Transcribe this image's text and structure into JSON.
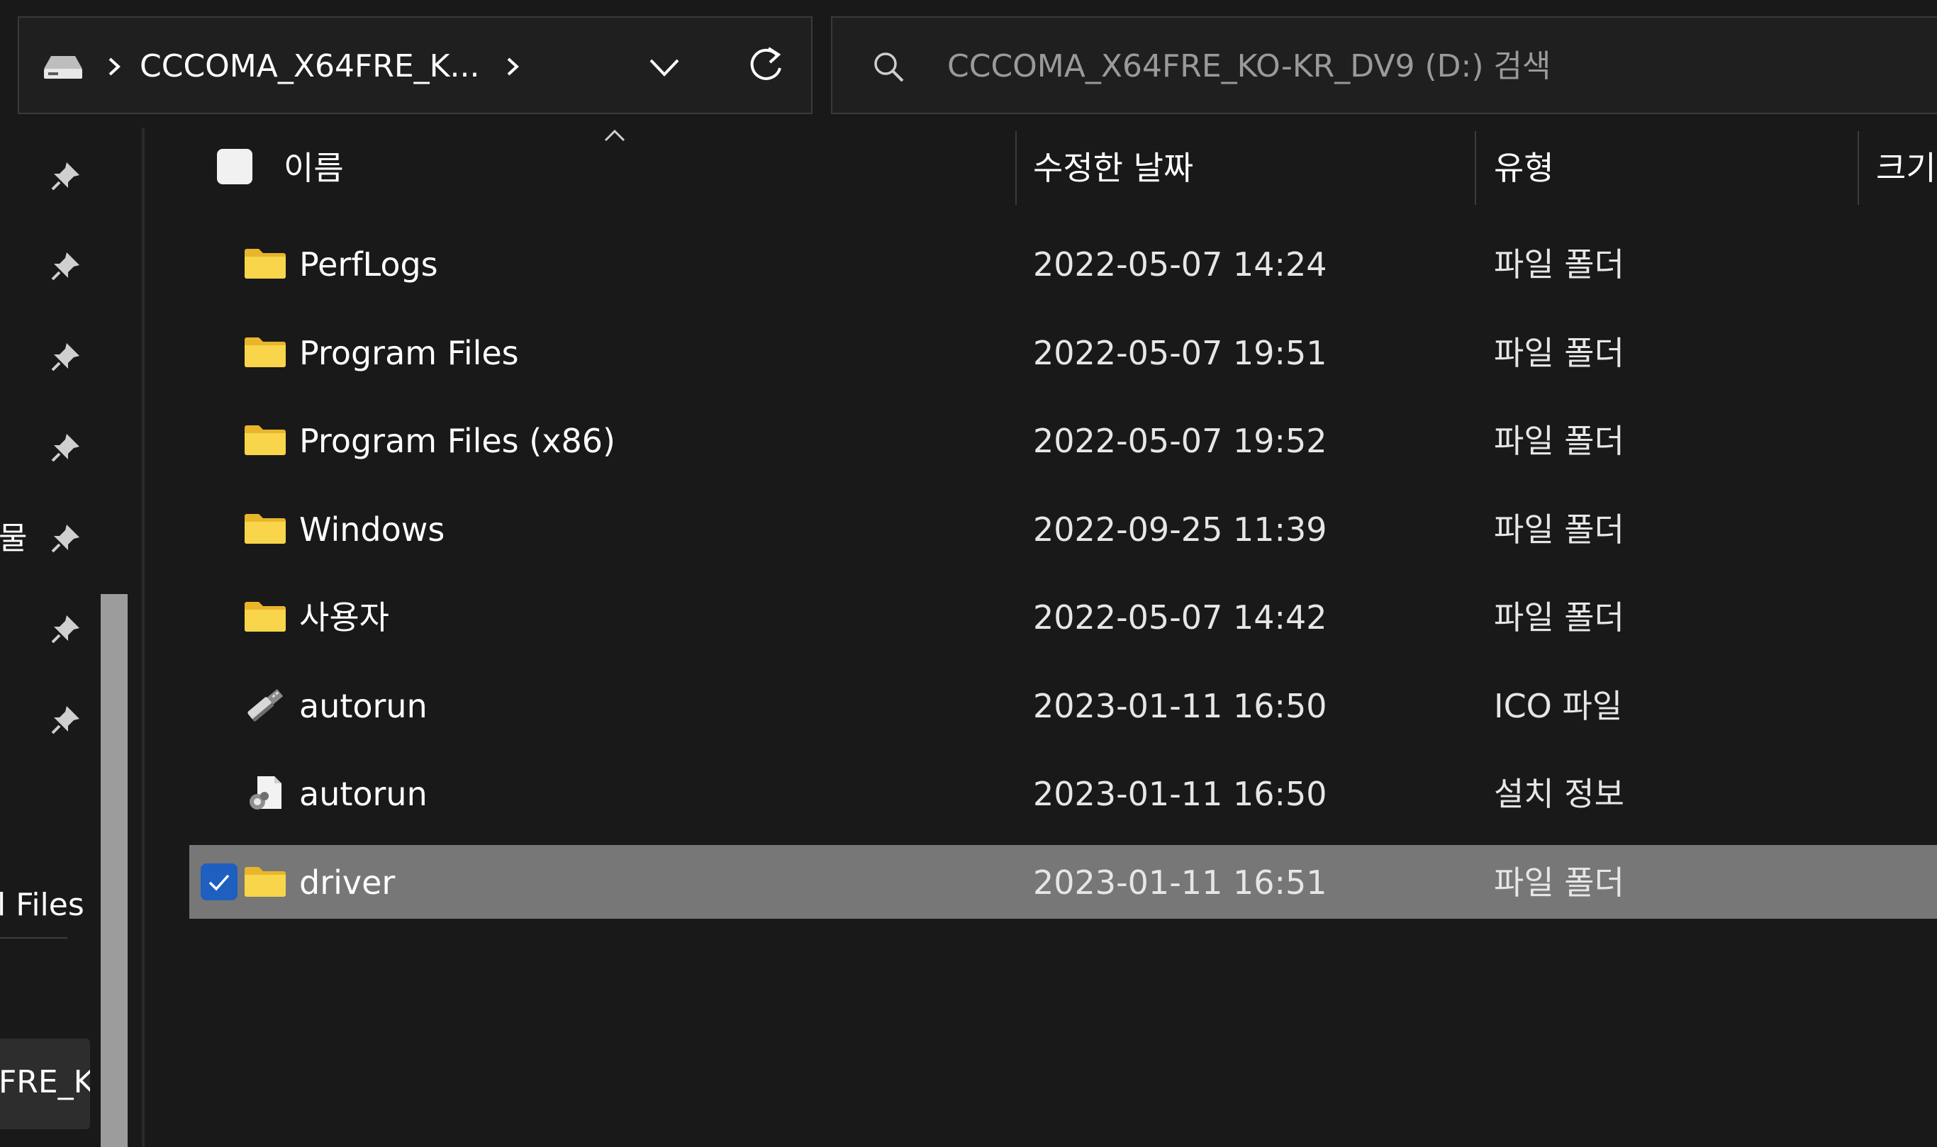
{
  "address_bar": {
    "breadcrumb": "CCCOMA_X64FRE_K...",
    "drive_icon": "drive-icon",
    "refresh_icon": "refresh-icon",
    "dropdown_icon": "chevron-down-icon"
  },
  "search": {
    "placeholder": "CCCOMA_X64FRE_KO-KR_DV9 (D:) 검색",
    "icon": "search-icon"
  },
  "nav": {
    "pinned_count": 7,
    "fragments": {
      "quick_item": "물",
      "program_files": "l Files",
      "drive": "FRE_K("
    }
  },
  "columns": {
    "name": "이름",
    "modified": "수정한 날짜",
    "type": "유형",
    "size": "크기"
  },
  "rows": [
    {
      "name": "PerfLogs",
      "modified": "2022-05-07 14:24",
      "type": "파일 폴더",
      "icon": "folder-icon",
      "selected": false
    },
    {
      "name": "Program Files",
      "modified": "2022-05-07 19:51",
      "type": "파일 폴더",
      "icon": "folder-icon",
      "selected": false
    },
    {
      "name": "Program Files (x86)",
      "modified": "2022-05-07 19:52",
      "type": "파일 폴더",
      "icon": "folder-icon",
      "selected": false
    },
    {
      "name": "Windows",
      "modified": "2022-09-25 11:39",
      "type": "파일 폴더",
      "icon": "folder-icon",
      "selected": false
    },
    {
      "name": "사용자",
      "modified": "2022-05-07 14:42",
      "type": "파일 폴더",
      "icon": "folder-icon",
      "selected": false
    },
    {
      "name": "autorun",
      "modified": "2023-01-11 16:50",
      "type": "ICO 파일",
      "icon": "usb-drive-icon",
      "selected": false
    },
    {
      "name": "autorun",
      "modified": "2023-01-11 16:50",
      "type": "설치 정보",
      "icon": "setup-info-file-icon",
      "selected": false
    },
    {
      "name": "driver",
      "modified": "2023-01-11 16:51",
      "type": "파일 폴더",
      "icon": "folder-icon",
      "selected": true
    }
  ],
  "colors": {
    "background": "#191919",
    "selection": "#777777",
    "checkbox_accent": "#1f5fbf",
    "folder": "#f4c93a"
  }
}
